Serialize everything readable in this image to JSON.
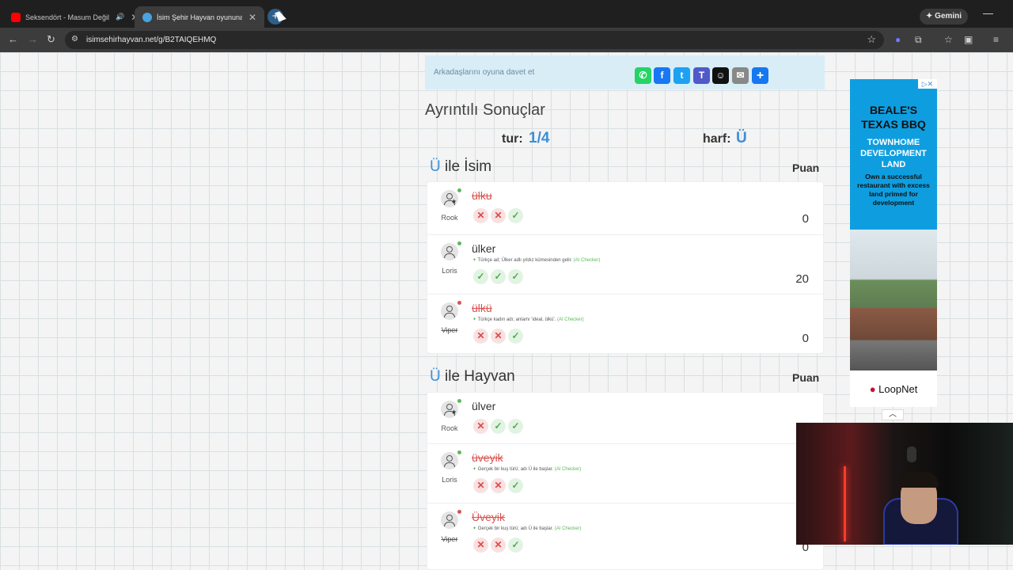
{
  "browser": {
    "tabs": [
      {
        "title": "Seksendört - Masum Değil",
        "active": false,
        "audio": true,
        "favicon_color": "#ff0000"
      },
      {
        "title": "İsim Şehir Hayvan oyununa katı",
        "active": true,
        "audio": false,
        "favicon_color": "#4aa3df"
      }
    ],
    "new_tab_symbol": "+",
    "gemini_label": "Gemini",
    "url": "isimsehirhayvan.net/g/B2TAIQEHMQ"
  },
  "invite": {
    "text": "Arkadaşlarını oyuna davet et",
    "share_buttons": [
      {
        "name": "whatsapp",
        "glyph": "✆",
        "color": "#25d366"
      },
      {
        "name": "facebook",
        "glyph": "f",
        "color": "#1877f2"
      },
      {
        "name": "twitter",
        "glyph": "t",
        "color": "#1da1f2"
      },
      {
        "name": "teams",
        "glyph": "T",
        "color": "#5059c9"
      },
      {
        "name": "snapchat",
        "glyph": "👻",
        "color": "#111111"
      },
      {
        "name": "email",
        "glyph": "✉",
        "color": "#888888"
      },
      {
        "name": "more",
        "glyph": "+",
        "color": "#1677f0"
      }
    ]
  },
  "results": {
    "title": "Ayrıntılı Sonuçlar",
    "tur_label": "tur:",
    "tur_value": "1/4",
    "harf_label": "harf:",
    "harf_value": "Ü"
  },
  "sections": [
    {
      "letter": "Ü",
      "title": "ile İsim",
      "puan_label": "Puan",
      "rows": [
        {
          "player": "Rook",
          "host": true,
          "online": true,
          "player_struck": false,
          "answer": "ülku",
          "valid": false,
          "note": "",
          "votes": [
            "x",
            "x",
            "ok"
          ],
          "score": "0"
        },
        {
          "player": "Loris",
          "host": false,
          "online": true,
          "player_struck": false,
          "answer": "ülker",
          "valid": true,
          "note": "Türkçe ad; Ülker adlı yıldız kümesinden gelir.",
          "ai": "(AI Checker)",
          "votes": [
            "ok",
            "ok",
            "ok"
          ],
          "score": "20"
        },
        {
          "player": "Viper",
          "host": false,
          "online": false,
          "player_struck": true,
          "answer": "ülkü",
          "valid": false,
          "note": "Türkçe kadın adı; anlamı 'ideal, ülkü'.",
          "ai": "(AI Checker)",
          "votes": [
            "x",
            "x",
            "ok"
          ],
          "score": "0"
        }
      ]
    },
    {
      "letter": "Ü",
      "title": "ile Hayvan",
      "puan_label": "Puan",
      "rows": [
        {
          "player": "Rook",
          "host": true,
          "online": true,
          "player_struck": false,
          "answer": "ülver",
          "valid": true,
          "note": "",
          "votes": [
            "x",
            "ok",
            "ok"
          ],
          "score": ""
        },
        {
          "player": "Loris",
          "host": false,
          "online": true,
          "player_struck": false,
          "answer": "üveyik",
          "valid": false,
          "note": "Gerçek bir kuş türü; adı Ü ile başlar.",
          "ai": "(AI Checker)",
          "votes": [
            "x",
            "x",
            "ok"
          ],
          "score": ""
        },
        {
          "player": "Viper",
          "host": false,
          "online": false,
          "player_struck": true,
          "answer": "Üveyik",
          "valid": false,
          "note": "Gerçek bir kuş türü; adı Ü ile başlar.",
          "ai": "(AI Checker)",
          "votes": [
            "x",
            "x",
            "ok"
          ],
          "score": "0"
        }
      ]
    }
  ],
  "ad": {
    "headline": "BEALE'S TEXAS BBQ",
    "subhead": "TOWNHOME DEVELOPMENT LAND",
    "body": "Own a successful restaurant with excess land primed for development",
    "brand": "LoopNet",
    "corner": "▷✕"
  },
  "colors": {
    "accent": "#3a8fd9",
    "invalid": "#d9534f",
    "valid_vote": "#4cae4c",
    "invalid_vote": "#e04848"
  }
}
